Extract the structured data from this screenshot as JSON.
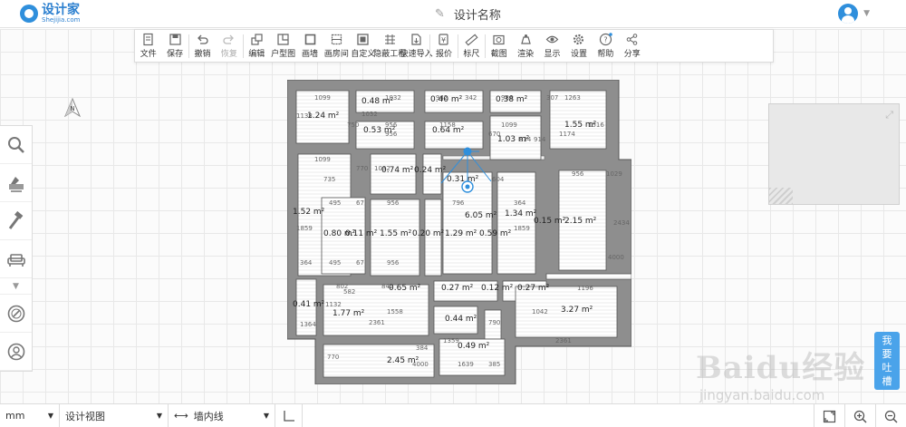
{
  "header": {
    "logo_main": "设计家",
    "logo_sub": "Shejijia.com",
    "design_name": "设计名称"
  },
  "toolbar": {
    "items": [
      {
        "label": "文件",
        "icon": "file-icon",
        "disabled": false
      },
      {
        "label": "保存",
        "icon": "save-icon",
        "disabled": false
      },
      {
        "label": "撤销",
        "icon": "undo-icon",
        "disabled": false
      },
      {
        "label": "恢复",
        "icon": "redo-icon",
        "disabled": true
      },
      {
        "label": "编辑",
        "icon": "edit-icon",
        "disabled": false
      },
      {
        "label": "户型图",
        "icon": "floorplan-icon",
        "disabled": false
      },
      {
        "label": "画墙",
        "icon": "draw-wall-icon",
        "disabled": false
      },
      {
        "label": "画房间",
        "icon": "draw-room-icon",
        "disabled": false
      },
      {
        "label": "自定义",
        "icon": "custom-icon",
        "disabled": false
      },
      {
        "label": "隐蔽工程",
        "icon": "hidden-works-icon",
        "disabled": false
      },
      {
        "label": "快速导入",
        "icon": "quick-import-icon",
        "disabled": false
      },
      {
        "label": "报价",
        "icon": "quote-icon",
        "disabled": false
      },
      {
        "label": "标尺",
        "icon": "ruler-icon",
        "disabled": false
      },
      {
        "label": "截图",
        "icon": "screenshot-icon",
        "disabled": false
      },
      {
        "label": "渲染",
        "icon": "render-icon",
        "disabled": false
      },
      {
        "label": "显示",
        "icon": "eye-icon",
        "disabled": false
      },
      {
        "label": "设置",
        "icon": "gear-icon",
        "disabled": false
      },
      {
        "label": "帮助",
        "icon": "help-icon",
        "disabled": false
      },
      {
        "label": "分享",
        "icon": "share-icon",
        "disabled": false
      }
    ]
  },
  "floorplan": {
    "area_labels": [
      "1.24 m²",
      "0.48 m²",
      "0.40 m²",
      "0.38 m²",
      "1.55 m²",
      "0.53 m²",
      "0.64 m²",
      "1.03 m²",
      "0.74 m²",
      "0.24 m²",
      "0.31 m²",
      "1.52 m²",
      "6.05 m²",
      "1.34 m²",
      "0.15 m²",
      "2.15 m²",
      "0.80 m²",
      "0.11 m²",
      "1.55 m²",
      "0.20 m²",
      "1.29 m²",
      "0.59 m²",
      "0.41 m²",
      "0.65 m²",
      "0.27 m²",
      "0.12 m²",
      "0.27 m²",
      "1.77 m²",
      "0.44 m²",
      "3.27 m²",
      "0.49 m²",
      "2.45 m²"
    ],
    "dimension_labels": [
      "1099",
      "1032",
      "942",
      "342",
      "986",
      "307",
      "1263",
      "1138",
      "1032",
      "956",
      "1158",
      "1099",
      "1516",
      "750",
      "956",
      "670",
      "1174",
      "834",
      "914",
      "1099",
      "770",
      "1032",
      "735",
      "604",
      "956",
      "1029",
      "495",
      "67",
      "956",
      "796",
      "364",
      "2434",
      "1859",
      "1859",
      "4000",
      "364",
      "495",
      "67",
      "956",
      "802",
      "842",
      "582",
      "1196",
      "1132",
      "1558",
      "1042",
      "2361",
      "790",
      "1364",
      "2361",
      "770",
      "384",
      "1359",
      "4000",
      "1639",
      "385"
    ]
  },
  "feedback": {
    "line1": "我",
    "line2": "要",
    "line3": "吐",
    "line4": "槽"
  },
  "watermark": {
    "brand": "Baidu",
    "brand_cn": "经验",
    "url": "jingyan.baidu.com"
  },
  "bottombar": {
    "unit": "mm",
    "view": "设计视图",
    "wall_mode": "墙内线"
  },
  "colors": {
    "brand": "#2f8fdc",
    "wall": "#8e8e8e",
    "room": "#ffffff",
    "feedback": "#4aa3ea"
  }
}
